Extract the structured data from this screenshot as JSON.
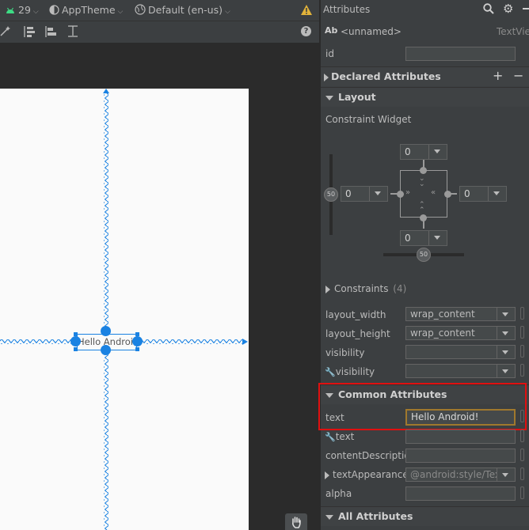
{
  "toolbar": {
    "api_level": "29",
    "theme": "AppTheme",
    "locale": "Default (en-us)",
    "help": "?"
  },
  "canvas": {
    "widget_text": "Hello Android!"
  },
  "attributes": {
    "title": "Attributes",
    "widget_name": "<unnamed>",
    "widget_type": "TextView",
    "widget_icon_text": "Ab",
    "id_label": "id",
    "id_value": "",
    "declared_section": "Declared Attributes",
    "declared_add": "+",
    "declared_remove": "−",
    "layout_section": "Layout",
    "constraint_widget_label": "Constraint Widget",
    "margins": {
      "top": "0",
      "left": "0",
      "right": "0",
      "bottom": "0"
    },
    "bias_vertical": "50",
    "bias_horizontal": "50",
    "constraints_label": "Constraints",
    "constraints_count": "(4)",
    "layout_width_label": "layout_width",
    "layout_width_value": "wrap_content",
    "layout_height_label": "layout_height",
    "layout_height_value": "wrap_content",
    "visibility_label": "visibility",
    "visibility_value": "",
    "tools_visibility_label": "visibility",
    "tools_visibility_value": "",
    "common_section": "Common Attributes",
    "text_label": "text",
    "text_value": "Hello Android!",
    "tools_text_label": "text",
    "tools_text_value": "",
    "content_desc_label": "contentDescription",
    "content_desc_value": "",
    "text_appearance_label": "textAppearance",
    "text_appearance_value": "@android:style/TextAppearance.Material.Small",
    "alpha_label": "alpha",
    "alpha_value": "",
    "all_section": "All Attributes"
  },
  "colors": {
    "highlight_red": "#e01010",
    "selection_blue": "#1a82e2",
    "warning_yellow": "#e2b33a",
    "focus_orange": "#a0782d"
  }
}
